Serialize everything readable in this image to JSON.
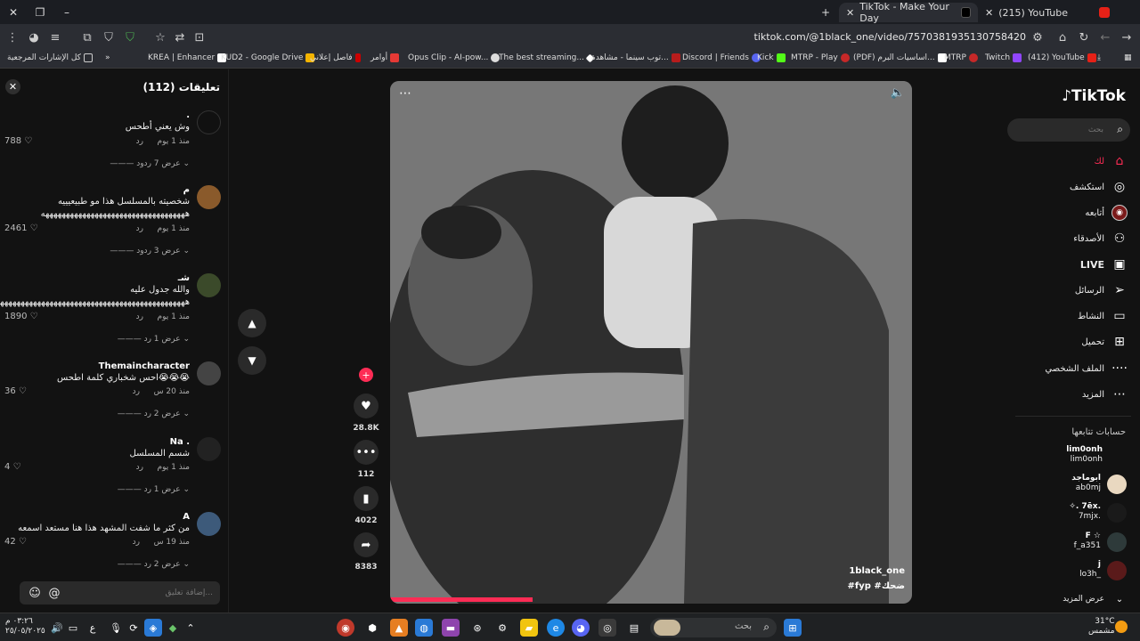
{
  "browser": {
    "tabs": [
      {
        "label": "TikTok - Make Your Day",
        "active": true
      },
      {
        "label": "(215) YouTube",
        "active": false
      }
    ],
    "url": "tiktok.com/@1black_one/video/7570381935130758420",
    "bookmarks": [
      "كل الإشارات المرجعية",
      "KREA | Enhancer",
      "KUD2 - Google Drive",
      "فاصل إعلاني",
      "أوامر",
      "Opus Clip - AI-pow...",
      "The best streaming...",
      "توب سينما - مشاهدة...",
      "Discord | Friends",
      "Kick",
      "MTRP - Play",
      "(PDF) اساسيات البرم...",
      "MTRP",
      "Twitch",
      "(412) YouTube"
    ]
  },
  "comments": {
    "title": "تعليقات (112)",
    "input_placeholder": "إضافة تعليق...",
    "items": [
      {
        "name": ".",
        "text": "وش يعني أطحس",
        "time": "منذ 1 يوم",
        "reply": "رد",
        "likes": "788",
        "more": "عرض 7 ردود"
      },
      {
        "name": "م",
        "text": "شخصيته بالمسلسل هذا مو طبيعيييه هههههههههههههههههههههههههههههههههههه",
        "time": "منذ 1 يوم",
        "reply": "رد",
        "likes": "2461",
        "more": "عرض 3 ردود"
      },
      {
        "name": "شـ",
        "text": "والله جدول عليه هههههههههههههههههههههههههههههههههههههههههههههههه",
        "time": "منذ 1 يوم",
        "reply": "رد",
        "likes": "1890",
        "more": "عرض 1 رد"
      },
      {
        "name": "Themaincharacter",
        "text": "احس شخباري كلمة اطحس😭😭😭",
        "time": "منذ 20 س",
        "reply": "رد",
        "likes": "36",
        "more": "عرض 2 رد"
      },
      {
        "name": "Na .",
        "text": "شسم المسلسل",
        "time": "منذ 1 يوم",
        "reply": "رد",
        "likes": "4",
        "more": "عرض 1 رد"
      },
      {
        "name": "A",
        "text": "من كثر ما شفت المشهد هذا هنا مستعد اسمعه",
        "time": "منذ 19 س",
        "reply": "رد",
        "likes": "42",
        "more": "عرض 2 رد"
      }
    ]
  },
  "video": {
    "author": "1black_one",
    "tags": "#fyp #ضحك",
    "likes": "28.8K",
    "comments": "112",
    "saves": "4022",
    "shares": "8383"
  },
  "sidebar": {
    "logo": "TikTok",
    "search_placeholder": "بحث",
    "nav": [
      "لك",
      "استكشف",
      "أتابعه",
      "الأصدقاء",
      "LIVE",
      "الرسائل",
      "النشاط",
      "تحميل",
      "الملف الشخصي",
      "المزيد"
    ],
    "following_title": "حسابات تتابعها",
    "following": [
      {
        "name": "lim0onh",
        "handle": "lim0onh"
      },
      {
        "name": "ابوماجد",
        "handle": "ab0mj"
      },
      {
        "name": "✧. 7ēx.",
        "handle": "7mjx."
      },
      {
        "name": "F ☆",
        "handle": "f_a351"
      },
      {
        "name": "j",
        "handle": "lo3h_"
      }
    ],
    "show_more": "عرض المزيد"
  },
  "taskbar": {
    "search_placeholder": "بحث",
    "weather_temp": "31°C",
    "weather_label": "مشمس",
    "time": "٠٣:٢٦ م",
    "date": "٢٥/٠٥/٢٠٢٥"
  }
}
